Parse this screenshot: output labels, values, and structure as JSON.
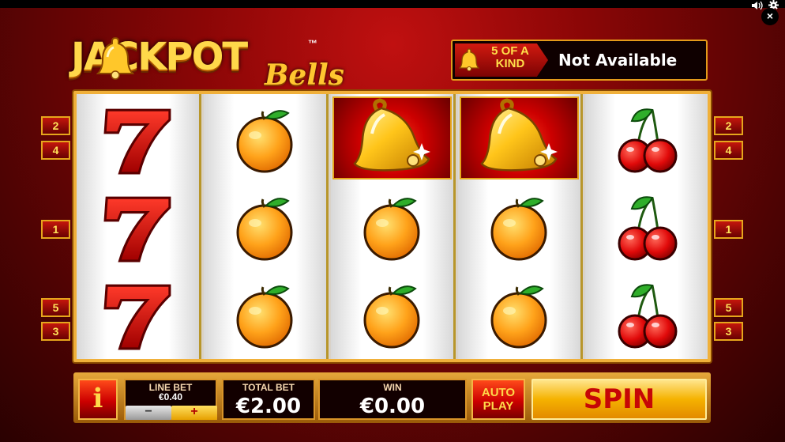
{
  "title": {
    "main": "JACKPOT",
    "trademark": "™",
    "sub": "Bells"
  },
  "feature": {
    "tag": "5 OF A KIND",
    "status": "Not Available"
  },
  "paylines": {
    "left": [
      "2",
      "4",
      "1",
      "5",
      "3"
    ],
    "right": [
      "2",
      "4",
      "1",
      "5",
      "3"
    ]
  },
  "reels": [
    [
      "seven-icon",
      "seven-icon",
      "seven-icon"
    ],
    [
      "orange-icon",
      "orange-icon",
      "orange-icon"
    ],
    [
      "bell-icon",
      "orange-icon",
      "orange-icon"
    ],
    [
      "bell-icon",
      "orange-icon",
      "orange-icon"
    ],
    [
      "cherry-icon",
      "cherry-icon",
      "cherry-icon"
    ]
  ],
  "highlighted": [
    [
      2,
      0
    ],
    [
      3,
      0
    ]
  ],
  "controls": {
    "info_label": "i",
    "line_bet_label": "LINE BET",
    "line_bet_value": "€0.40",
    "minus_label": "−",
    "plus_label": "+",
    "total_bet_label": "TOTAL BET",
    "total_bet_value": "€2.00",
    "win_label": "WIN",
    "win_value": "€0.00",
    "autoplay_label_1": "AUTO",
    "autoplay_label_2": "PLAY",
    "spin_label": "SPIN"
  },
  "window": {
    "sound_icon": "speaker-icon",
    "settings_icon": "gear-icon",
    "close_label": "×"
  },
  "colors": {
    "accent_gold": "#f0b03a",
    "spin_text": "#c60606",
    "background_red": "#8a0606"
  }
}
